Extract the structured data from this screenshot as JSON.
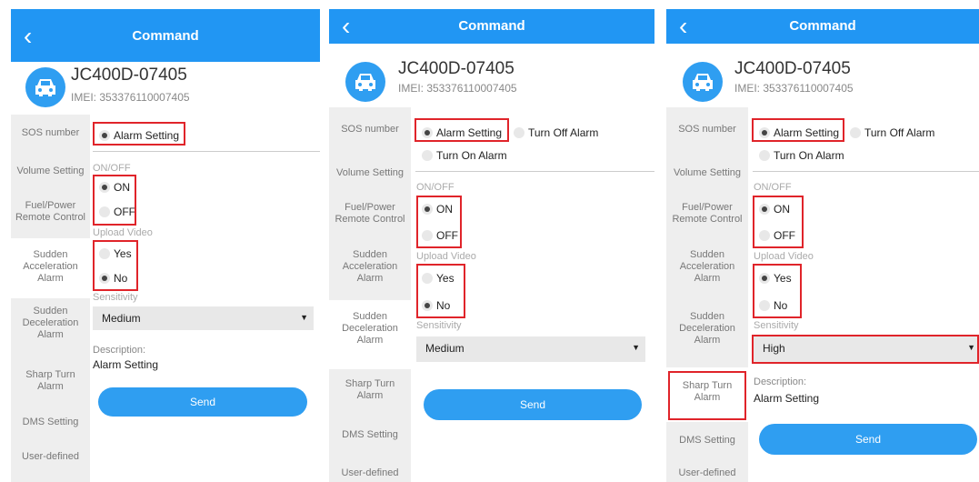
{
  "header": {
    "back_icon": "chevron-left-icon",
    "title": "Command"
  },
  "device": {
    "name": "JC400D-07405",
    "imei": "IMEI: 353376110007405",
    "icon": "car-icon"
  },
  "sidebar": {
    "items": [
      {
        "label": "SOS number"
      },
      {
        "label": "Volume Setting"
      },
      {
        "label": "Fuel/Power Remote Control"
      },
      {
        "label": "Sudden Acceleration Alarm"
      },
      {
        "label": "Sudden Deceleration Alarm"
      },
      {
        "label": "Sharp Turn Alarm"
      },
      {
        "label": "DMS Setting"
      },
      {
        "label": "User-defined"
      }
    ]
  },
  "form": {
    "alarm_setting": "Alarm Setting",
    "turn_off_alarm": "Turn Off Alarm",
    "turn_on_alarm": "Turn On Alarm",
    "onoff_label": "ON/OFF",
    "on": "ON",
    "off": "OFF",
    "upload_video_label": "Upload Video",
    "yes": "Yes",
    "no": "No",
    "sensitivity_label": "Sensitivity",
    "description_label": "Description:",
    "description_value": "Alarm Setting",
    "send": "Send"
  },
  "panels": [
    {
      "sensitivity": "Medium",
      "upload_video": "No",
      "onoff": "ON"
    },
    {
      "sensitivity": "Medium",
      "upload_video": "No",
      "onoff": "ON"
    },
    {
      "sensitivity": "High",
      "upload_video": "Yes",
      "onoff": "ON"
    }
  ],
  "colors": {
    "header": "#2196f3",
    "accent": "#2f9ef1",
    "highlight": "#e0242a",
    "sidebar": "#eeeeee"
  }
}
